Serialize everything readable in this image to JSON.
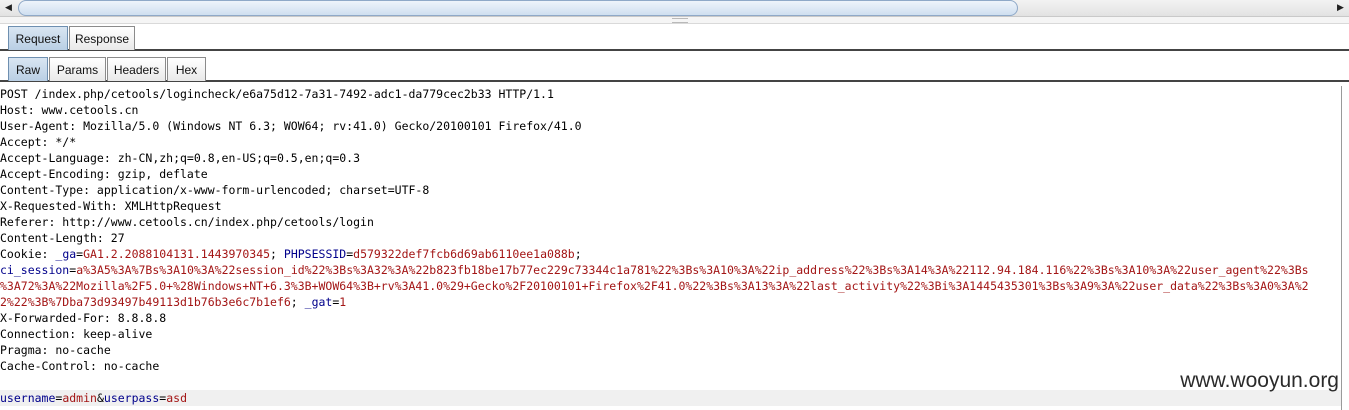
{
  "scrollbar": {
    "left_arrow": "◀",
    "right_arrow": "▶"
  },
  "tabs": {
    "request": "Request",
    "response": "Response"
  },
  "subtabs": {
    "raw": "Raw",
    "params": "Params",
    "headers": "Headers",
    "hex": "Hex"
  },
  "request": {
    "request_line": "POST /index.php/cetools/logincheck/e6a75d12-7a31-7492-adc1-da779cec2b33 HTTP/1.1",
    "host": "Host: www.cetools.cn",
    "user_agent": "User-Agent: Mozilla/5.0 (Windows NT 6.3; WOW64; rv:41.0) Gecko/20100101 Firefox/41.0",
    "accept": "Accept: */*",
    "accept_language": "Accept-Language: zh-CN,zh;q=0.8,en-US;q=0.5,en;q=0.3",
    "accept_encoding": "Accept-Encoding: gzip, deflate",
    "content_type": "Content-Type: application/x-www-form-urlencoded; charset=UTF-8",
    "x_requested_with": "X-Requested-With: XMLHttpRequest",
    "referer": "Referer: http://www.cetools.cn/index.php/cetools/login",
    "content_length": "Content-Length: 27",
    "cookie": {
      "label": "Cookie: ",
      "ga_name": "_ga",
      "ga_value": "GA1.2.2088104131.1443970345",
      "sep1": "; ",
      "phpsessid_name": "PHPSESSID",
      "phpsessid_value": "d579322def7fcb6d69ab6110ee1a088b",
      "sep2": ";",
      "ci_name": "ci_session",
      "ci_value_1": "a%3A5%3A%7Bs%3A10%3A%22session_id%22%3Bs%3A32%3A%22b823fb18be17b77ec229c73344c1a781%22%3Bs%3A10%3A%22ip_address%22%3Bs%3A14%3A%22112.94.184.116%22%3Bs%3A10%3A%22user_agent%22%3Bs",
      "ci_value_2": "%3A72%3A%22Mozilla%2F5.0+%28Windows+NT+6.3%3B+WOW64%3B+rv%3A41.0%29+Gecko%2F20100101+Firefox%2F41.0%22%3Bs%3A13%3A%22last_activity%22%3Bi%3A1445435301%3Bs%3A9%3A%22user_data%22%3Bs%3A0%3A%2",
      "ci_value_3": "2%22%3B%7Dba73d93497b49113d1b76b3e6c7b1ef6",
      "sep3": "; ",
      "gat_name": "_gat",
      "gat_value": "1"
    },
    "x_forwarded_for": "X-Forwarded-For: 8.8.8.8",
    "connection": "Connection: keep-alive",
    "pragma": "Pragma: no-cache",
    "cache_control": "Cache-Control: no-cache",
    "body": {
      "p1_name": "username",
      "p1_value": "admin",
      "amp": "&",
      "p2_name": "userpass",
      "p2_value": "asd"
    }
  },
  "watermark": "www.wooyun.org"
}
